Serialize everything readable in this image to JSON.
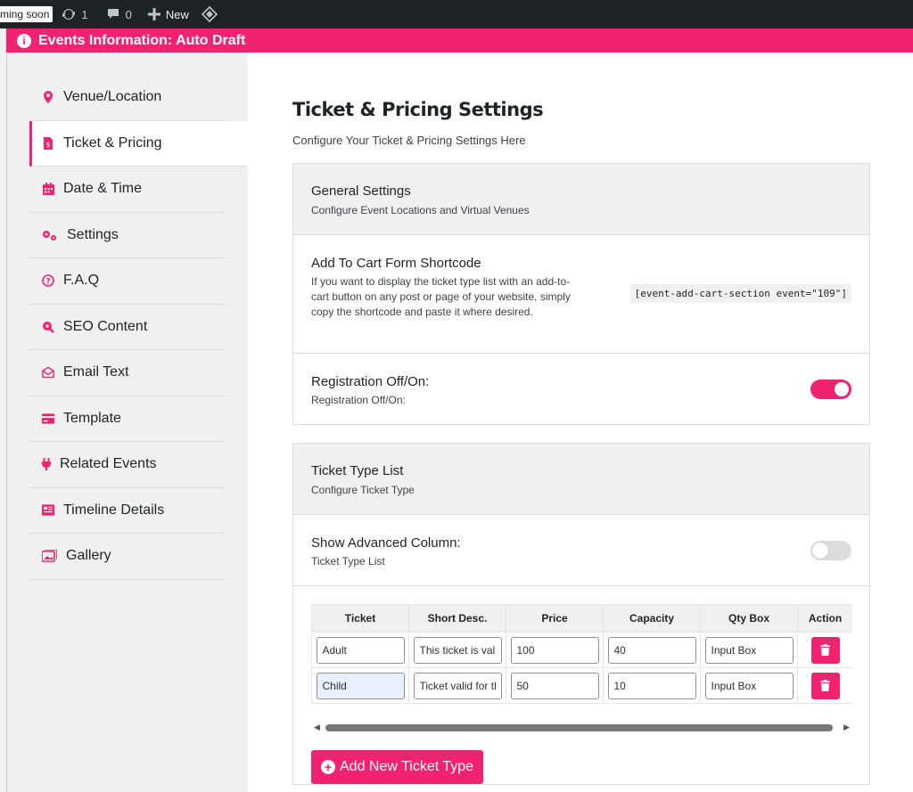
{
  "adminbar": {
    "coming_soon": "ming soon",
    "updates_count": "1",
    "comments_count": "0",
    "new_label": "New"
  },
  "metabox": {
    "title": "Events Information: Auto Draft"
  },
  "sidebar": {
    "items": [
      {
        "label": "Venue/Location",
        "icon": "map-marker-icon"
      },
      {
        "label": "Ticket & Pricing",
        "icon": "ticket-file-icon",
        "active": true
      },
      {
        "label": "Date & Time",
        "icon": "calendar-icon"
      },
      {
        "label": "Settings",
        "icon": "gears-icon"
      },
      {
        "label": "F.A.Q",
        "icon": "question-circle-icon"
      },
      {
        "label": "SEO Content",
        "icon": "search-marker-icon"
      },
      {
        "label": "Email Text",
        "icon": "envelope-open-icon"
      },
      {
        "label": "Template",
        "icon": "credit-card-icon"
      },
      {
        "label": "Related Events",
        "icon": "plug-icon"
      },
      {
        "label": "Timeline Details",
        "icon": "newspaper-icon"
      },
      {
        "label": "Gallery",
        "icon": "images-icon"
      }
    ]
  },
  "main": {
    "title": "Ticket & Pricing Settings",
    "subtitle": "Configure Your Ticket & Pricing Settings Here"
  },
  "general": {
    "title": "General Settings",
    "subtitle": "Configure Event Locations and Virtual Venues",
    "shortcode_title": "Add To Cart Form Shortcode",
    "shortcode_desc": "If you want to display the ticket type list with an add-to-cart button on any post or page of your website, simply copy the shortcode and paste it where desired.",
    "shortcode_value": "[event-add-cart-section event=\"109\"]",
    "registration_title": "Registration Off/On:",
    "registration_sub": "Registration Off/On:",
    "registration_on": true
  },
  "ticket_list": {
    "title": "Ticket Type List",
    "subtitle": "Configure Ticket Type",
    "advanced_title": "Show Advanced Column:",
    "advanced_sub": "Ticket Type List",
    "advanced_on": false,
    "columns": [
      "Ticket",
      "Short Desc.",
      "Price",
      "Capacity",
      "Qty Box",
      "Action"
    ],
    "rows": [
      {
        "ticket": "Adult",
        "desc": "This ticket is valid",
        "price": "100",
        "capacity": "40",
        "qty": "Input Box"
      },
      {
        "ticket": "Child",
        "desc": "Ticket valid for th",
        "price": "50",
        "capacity": "10",
        "qty": "Input Box"
      }
    ],
    "add_button": "Add New Ticket Type"
  },
  "colors": {
    "accent": "#f1226f",
    "adminbar": "#1d2327"
  }
}
